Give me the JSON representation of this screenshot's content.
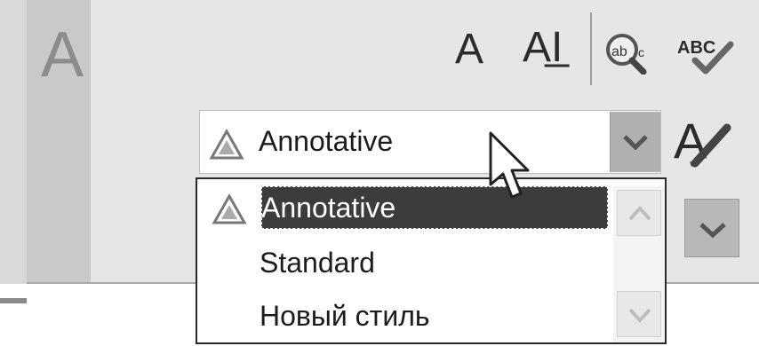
{
  "ribbon": {
    "big_icon_label": "A",
    "tool_a_label": "A",
    "tool_ai_label": "AI̲",
    "find_icon": "find-replace-icon",
    "spell_icon": "spell-check-icon"
  },
  "style_combo": {
    "value": "Annotative",
    "icon": "annotative-icon",
    "arrow_icon": "chevron-down-icon",
    "edit_icon": "edit-text-style-icon"
  },
  "dropdown": {
    "options": [
      {
        "label": "Annotative",
        "selected": true,
        "icon": "annotative-icon"
      },
      {
        "label": "Standard",
        "selected": false
      },
      {
        "label": "Новый стиль",
        "selected": false
      }
    ]
  },
  "colors": {
    "panel": "#e6e6e6",
    "selection": "#3c3c3c",
    "text": "#1c1c1c"
  }
}
